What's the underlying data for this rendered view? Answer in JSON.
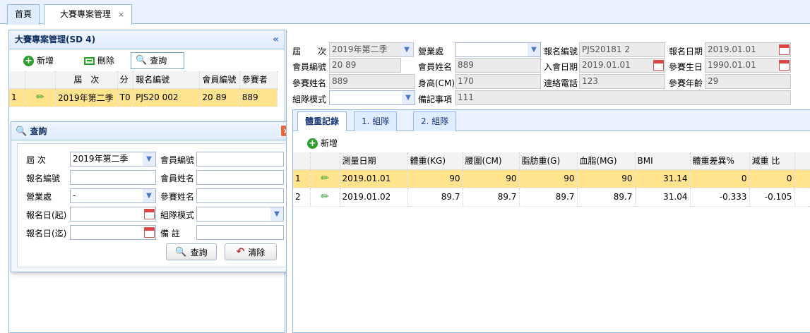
{
  "top_tabs": [
    {
      "label": "首頁"
    },
    {
      "label": "大賽專案管理",
      "close": "×"
    }
  ],
  "left_panel": {
    "title": "大賽專案管理(SD      4)",
    "collapse": "«",
    "toolbar": {
      "add": "新增",
      "delete": "刪除",
      "query": "查詢"
    },
    "grid": {
      "headers": [
        "",
        "",
        "屆　次",
        "分",
        "報名編號",
        "會員編號",
        "參賽者"
      ],
      "rows": [
        {
          "no": "1",
          "session": "2019年第二季",
          "cat": "T0",
          "reg_no": "PJS20         002",
          "member_no": "20      89",
          "participant": "889"
        }
      ]
    }
  },
  "query_dialog": {
    "title": "查詢",
    "close": "×",
    "labels": {
      "session": "屆 次",
      "member_no": "會員編號",
      "reg_no": "報名編號",
      "member_name": "會員姓名",
      "branch": "營業處",
      "participant_name": "參賽姓名",
      "reg_from": "報名日(起)",
      "group_mode": "組隊模式",
      "reg_to": "報名日(迄)",
      "remark": "備 註"
    },
    "values": {
      "session": "2019年第二季",
      "branch": "-"
    },
    "buttons": {
      "query": "查詢",
      "clear": "清除"
    }
  },
  "detail_form": {
    "labels": {
      "session": "屆　　次",
      "branch": "營業處",
      "reg_no": "報名編號",
      "reg_date": "報名日期",
      "member_no": "會員編號",
      "member_name": "會員姓名",
      "join_date": "入會日期",
      "birthday": "參賽生日",
      "participant_name": "參賽姓名",
      "height": "身高(CM)",
      "phone": "連絡電話",
      "age": "參賽年齡",
      "group_mode": "組隊模式",
      "note": "備記事項"
    },
    "values": {
      "session": "2019年第二季",
      "branch": "",
      "reg_no": "PJS20181        2",
      "reg_date": "2019.01.01",
      "member_no": "20        89",
      "member_name": "889",
      "join_date": "2019.01.01",
      "birthday": "1990.01.01",
      "participant_name": "889",
      "height": "170",
      "phone": "123",
      "age": "29",
      "group_mode": "",
      "note": "111"
    }
  },
  "inner_tabs": [
    {
      "label": "體重記錄"
    },
    {
      "label": "1.        組隊"
    },
    {
      "label": "2.        組隊"
    }
  ],
  "weight_toolbar": {
    "add": "新增"
  },
  "weight_grid": {
    "headers": [
      "",
      "",
      "測量日期",
      "體重(KG)",
      "腰圍(CM)",
      "脂肪重(G)",
      "血脂(MG)",
      "BMI",
      "體重差異%",
      "減重        比"
    ],
    "rows": [
      {
        "no": "1",
        "date": "2019.01.01",
        "weight": "90",
        "waist": "90",
        "fat": "90",
        "lipid": "90",
        "bmi": "31.14",
        "diff": "0",
        "ratio": "0"
      },
      {
        "no": "2",
        "date": "2019.01.02",
        "weight": "89.7",
        "waist": "89.7",
        "fat": "89.7",
        "lipid": "89.7",
        "bmi": "31.04",
        "diff": "-0.333",
        "ratio": "-0.105"
      }
    ]
  }
}
